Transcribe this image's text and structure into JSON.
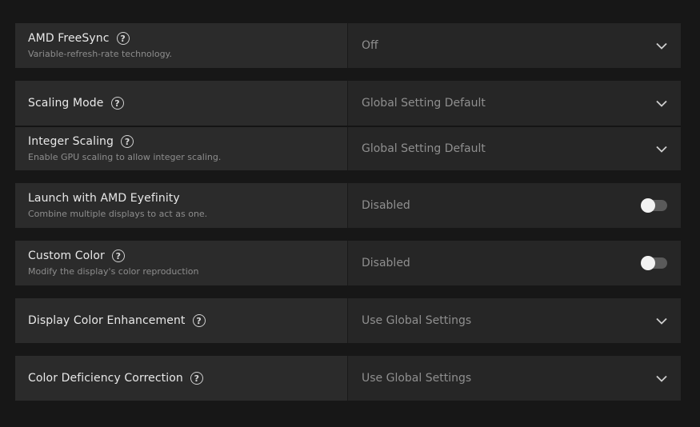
{
  "settings": {
    "freesync": {
      "label": "AMD FreeSync",
      "description": "Variable-refresh-rate technology.",
      "value": "Off",
      "icon": "help-icon",
      "control": "dropdown"
    },
    "scaling_mode": {
      "label": "Scaling Mode",
      "value": "Global Setting Default",
      "icon": "help-icon",
      "control": "dropdown"
    },
    "integer_scaling": {
      "label": "Integer Scaling",
      "description": "Enable GPU scaling to allow integer scaling.",
      "value": "Global Setting Default",
      "icon": "help-icon",
      "control": "dropdown"
    },
    "eyefinity": {
      "label": "Launch with AMD Eyefinity",
      "description": "Combine multiple displays to act as one.",
      "value": "Disabled",
      "control": "toggle",
      "enabled": false
    },
    "custom_color": {
      "label": "Custom Color",
      "description": "Modify the display's color reproduction",
      "value": "Disabled",
      "icon": "help-icon",
      "control": "toggle",
      "enabled": false
    },
    "color_enhancement": {
      "label": "Display Color Enhancement",
      "value": "Use Global Settings",
      "icon": "help-icon",
      "control": "dropdown"
    },
    "color_deficiency": {
      "label": "Color Deficiency Correction",
      "value": "Use Global Settings",
      "icon": "help-icon",
      "control": "dropdown"
    }
  },
  "help_glyph": "?",
  "colors": {
    "background": "#171717",
    "label_panel": "#2b2b2b",
    "value_panel": "#262626",
    "toggle_track_off": "#5a5a5a"
  }
}
